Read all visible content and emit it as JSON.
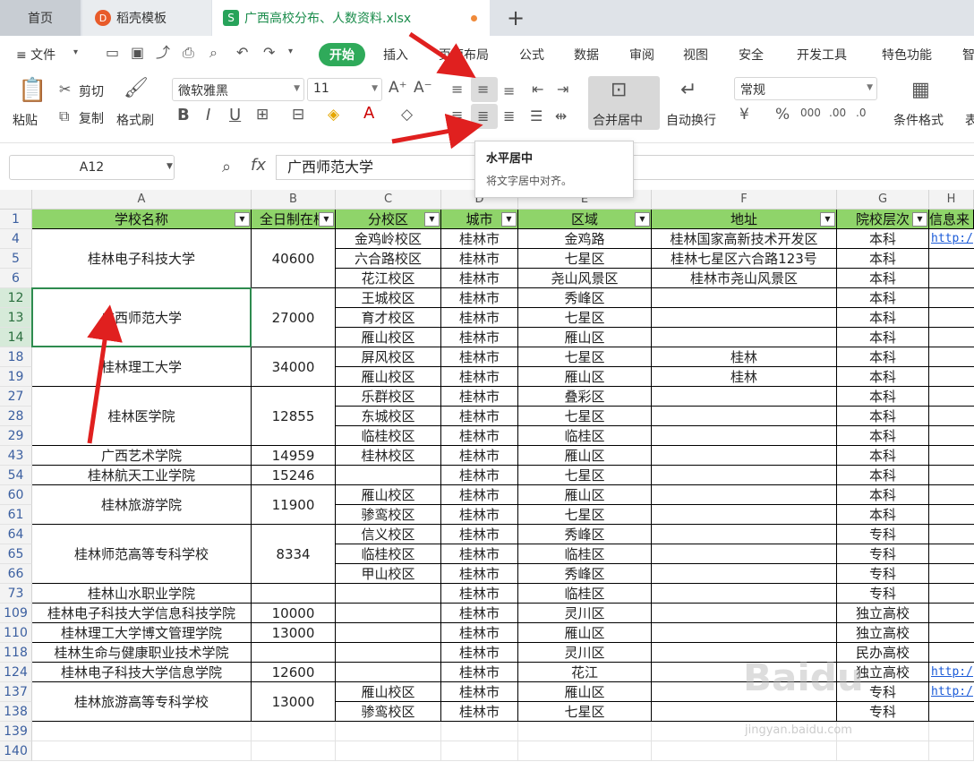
{
  "tabs": {
    "home": "首页",
    "template": "稻壳模板",
    "file": "广西高校分布、人数资料.xlsx",
    "new_tab": "+"
  },
  "menu": {
    "hamburger": "≡ 文件",
    "items": [
      "插入",
      "页面布局",
      "公式",
      "数据",
      "审阅",
      "视图",
      "安全",
      "开发工具",
      "特色功能",
      "智"
    ],
    "start": "开始"
  },
  "ribbon": {
    "paste": "粘贴",
    "cut": "剪切",
    "copy": "复制",
    "format_painter": "格式刷",
    "font_name": "微软雅黑",
    "font_size": "11",
    "merge_center": "合并居中",
    "wrap": "自动换行",
    "number_format": "常规",
    "cond_format": "条件格式",
    "table_partial": "表"
  },
  "formula_bar": {
    "cell_ref": "A12",
    "fx": "fx",
    "content": "广西师范大学"
  },
  "tooltip": {
    "title": "水平居中",
    "desc": "将文字居中对齐。"
  },
  "columns": [
    "A",
    "B",
    "C",
    "D",
    "E",
    "F",
    "G",
    "H"
  ],
  "headers": [
    "学校名称",
    "全日制在校",
    "分校区",
    "城市",
    "区域",
    "地址",
    "院校层次",
    "信息来"
  ],
  "row_numbers": [
    "1",
    "4",
    "5",
    "6",
    "12",
    "13",
    "14",
    "18",
    "19",
    "27",
    "28",
    "29",
    "43",
    "54",
    "60",
    "61",
    "64",
    "65",
    "66",
    "73",
    "109",
    "110",
    "118",
    "124",
    "137",
    "138",
    "139",
    "140"
  ],
  "schools": [
    {
      "name": "桂林电子科技大学",
      "count": "40600"
    },
    {
      "name": "广西师范大学",
      "count": "27000"
    },
    {
      "name": "桂林理工大学",
      "count": "34000"
    },
    {
      "name": "桂林医学院",
      "count": "12855"
    },
    {
      "name": "广西艺术学院",
      "count": "14959"
    },
    {
      "name": "桂林航天工业学院",
      "count": "15246"
    },
    {
      "name": "桂林旅游学院",
      "count": "11900"
    },
    {
      "name": "桂林师范高等专科学校",
      "count": "8334"
    },
    {
      "name": "桂林山水职业学院",
      "count": ""
    },
    {
      "name": "桂林电子科技大学信息科技学院",
      "count": "10000"
    },
    {
      "name": "桂林理工大学博文管理学院",
      "count": "13000"
    },
    {
      "name": "桂林生命与健康职业技术学院",
      "count": ""
    },
    {
      "name": "桂林电子科技大学信息学院",
      "count": "12600"
    },
    {
      "name": "桂林旅游高等专科学校",
      "count": "13000"
    }
  ],
  "rows": [
    {
      "campus": "金鸡岭校区",
      "city": "桂林市",
      "area": "金鸡路",
      "addr": "桂林国家高新技术开发区",
      "level": "本科",
      "info": "http:/"
    },
    {
      "campus": "六合路校区",
      "city": "桂林市",
      "area": "七星区",
      "addr": "桂林七星区六合路123号",
      "level": "本科",
      "info": ""
    },
    {
      "campus": "花江校区",
      "city": "桂林市",
      "area": "尧山风景区",
      "addr": "桂林市尧山风景区",
      "level": "本科",
      "info": ""
    },
    {
      "campus": "王城校区",
      "city": "桂林市",
      "area": "秀峰区",
      "addr": "",
      "level": "本科",
      "info": ""
    },
    {
      "campus": "育才校区",
      "city": "桂林市",
      "area": "七星区",
      "addr": "",
      "level": "本科",
      "info": ""
    },
    {
      "campus": "雁山校区",
      "city": "桂林市",
      "area": "雁山区",
      "addr": "",
      "level": "本科",
      "info": ""
    },
    {
      "campus": "屏风校区",
      "city": "桂林市",
      "area": "七星区",
      "addr": "桂林",
      "level": "本科",
      "info": ""
    },
    {
      "campus": "雁山校区",
      "city": "桂林市",
      "area": "雁山区",
      "addr": "桂林",
      "level": "本科",
      "info": ""
    },
    {
      "campus": "乐群校区",
      "city": "桂林市",
      "area": "叠彩区",
      "addr": "",
      "level": "本科",
      "info": ""
    },
    {
      "campus": "东城校区",
      "city": "桂林市",
      "area": "七星区",
      "addr": "",
      "level": "本科",
      "info": ""
    },
    {
      "campus": "临桂校区",
      "city": "桂林市",
      "area": "临桂区",
      "addr": "",
      "level": "本科",
      "info": ""
    },
    {
      "campus": "桂林校区",
      "city": "桂林市",
      "area": "雁山区",
      "addr": "",
      "level": "本科",
      "info": ""
    },
    {
      "campus": "",
      "city": "桂林市",
      "area": "七星区",
      "addr": "",
      "level": "本科",
      "info": ""
    },
    {
      "campus": "雁山校区",
      "city": "桂林市",
      "area": "雁山区",
      "addr": "",
      "level": "本科",
      "info": ""
    },
    {
      "campus": "骖鸾校区",
      "city": "桂林市",
      "area": "七星区",
      "addr": "",
      "level": "本科",
      "info": ""
    },
    {
      "campus": "信义校区",
      "city": "桂林市",
      "area": "秀峰区",
      "addr": "",
      "level": "专科",
      "info": ""
    },
    {
      "campus": "临桂校区",
      "city": "桂林市",
      "area": "临桂区",
      "addr": "",
      "level": "专科",
      "info": ""
    },
    {
      "campus": "甲山校区",
      "city": "桂林市",
      "area": "秀峰区",
      "addr": "",
      "level": "专科",
      "info": ""
    },
    {
      "campus": "",
      "city": "桂林市",
      "area": "临桂区",
      "addr": "",
      "level": "专科",
      "info": ""
    },
    {
      "campus": "",
      "city": "桂林市",
      "area": "灵川区",
      "addr": "",
      "level": "独立高校",
      "info": ""
    },
    {
      "campus": "",
      "city": "桂林市",
      "area": "雁山区",
      "addr": "",
      "level": "独立高校",
      "info": ""
    },
    {
      "campus": "",
      "city": "桂林市",
      "area": "灵川区",
      "addr": "",
      "level": "民办高校",
      "info": ""
    },
    {
      "campus": "",
      "city": "桂林市",
      "area": "花江",
      "addr": "",
      "level": "独立高校",
      "info": "http:/"
    },
    {
      "campus": "雁山校区",
      "city": "桂林市",
      "area": "雁山区",
      "addr": "",
      "level": "专科",
      "info": "http:/"
    },
    {
      "campus": "骖鸾校区",
      "city": "桂林市",
      "area": "七星区",
      "addr": "",
      "level": "专科",
      "info": ""
    }
  ],
  "watermark": {
    "logo": "Baidu",
    "url": "jingyan.baidu.com"
  },
  "colors": {
    "accent": "#2faa5a",
    "header_fill": "#8fd46a",
    "arrow": "#e0201f",
    "link": "#1b5bd8"
  }
}
